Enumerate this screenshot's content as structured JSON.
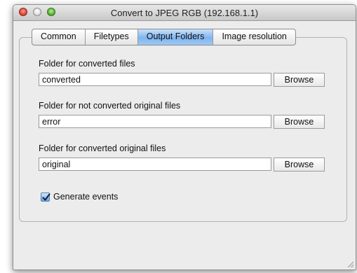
{
  "window": {
    "title": "Convert to JPEG RGB (192.168.1.1)"
  },
  "tabs": [
    {
      "label": "Common",
      "active": false
    },
    {
      "label": "Filetypes",
      "active": false
    },
    {
      "label": "Output Folders",
      "active": true
    },
    {
      "label": "Image resolution",
      "active": false
    }
  ],
  "folders": {
    "converted": {
      "label": "Folder for converted files",
      "value": "converted",
      "button": "Browse"
    },
    "not_converted_original": {
      "label": "Folder for not converted original files",
      "value": "error",
      "button": "Browse"
    },
    "converted_original": {
      "label": "Folder for converted original files",
      "value": "original",
      "button": "Browse"
    }
  },
  "generate_events": {
    "label": "Generate events",
    "checked": true
  },
  "icons": {
    "close": "close-button",
    "minimize": "minimize-button",
    "zoom": "zoom-button",
    "check": "checkmark-icon",
    "resize": "resize-grip-icon"
  },
  "colors": {
    "tab_active": "#7fb5ee",
    "window_bg": "#ececec"
  }
}
